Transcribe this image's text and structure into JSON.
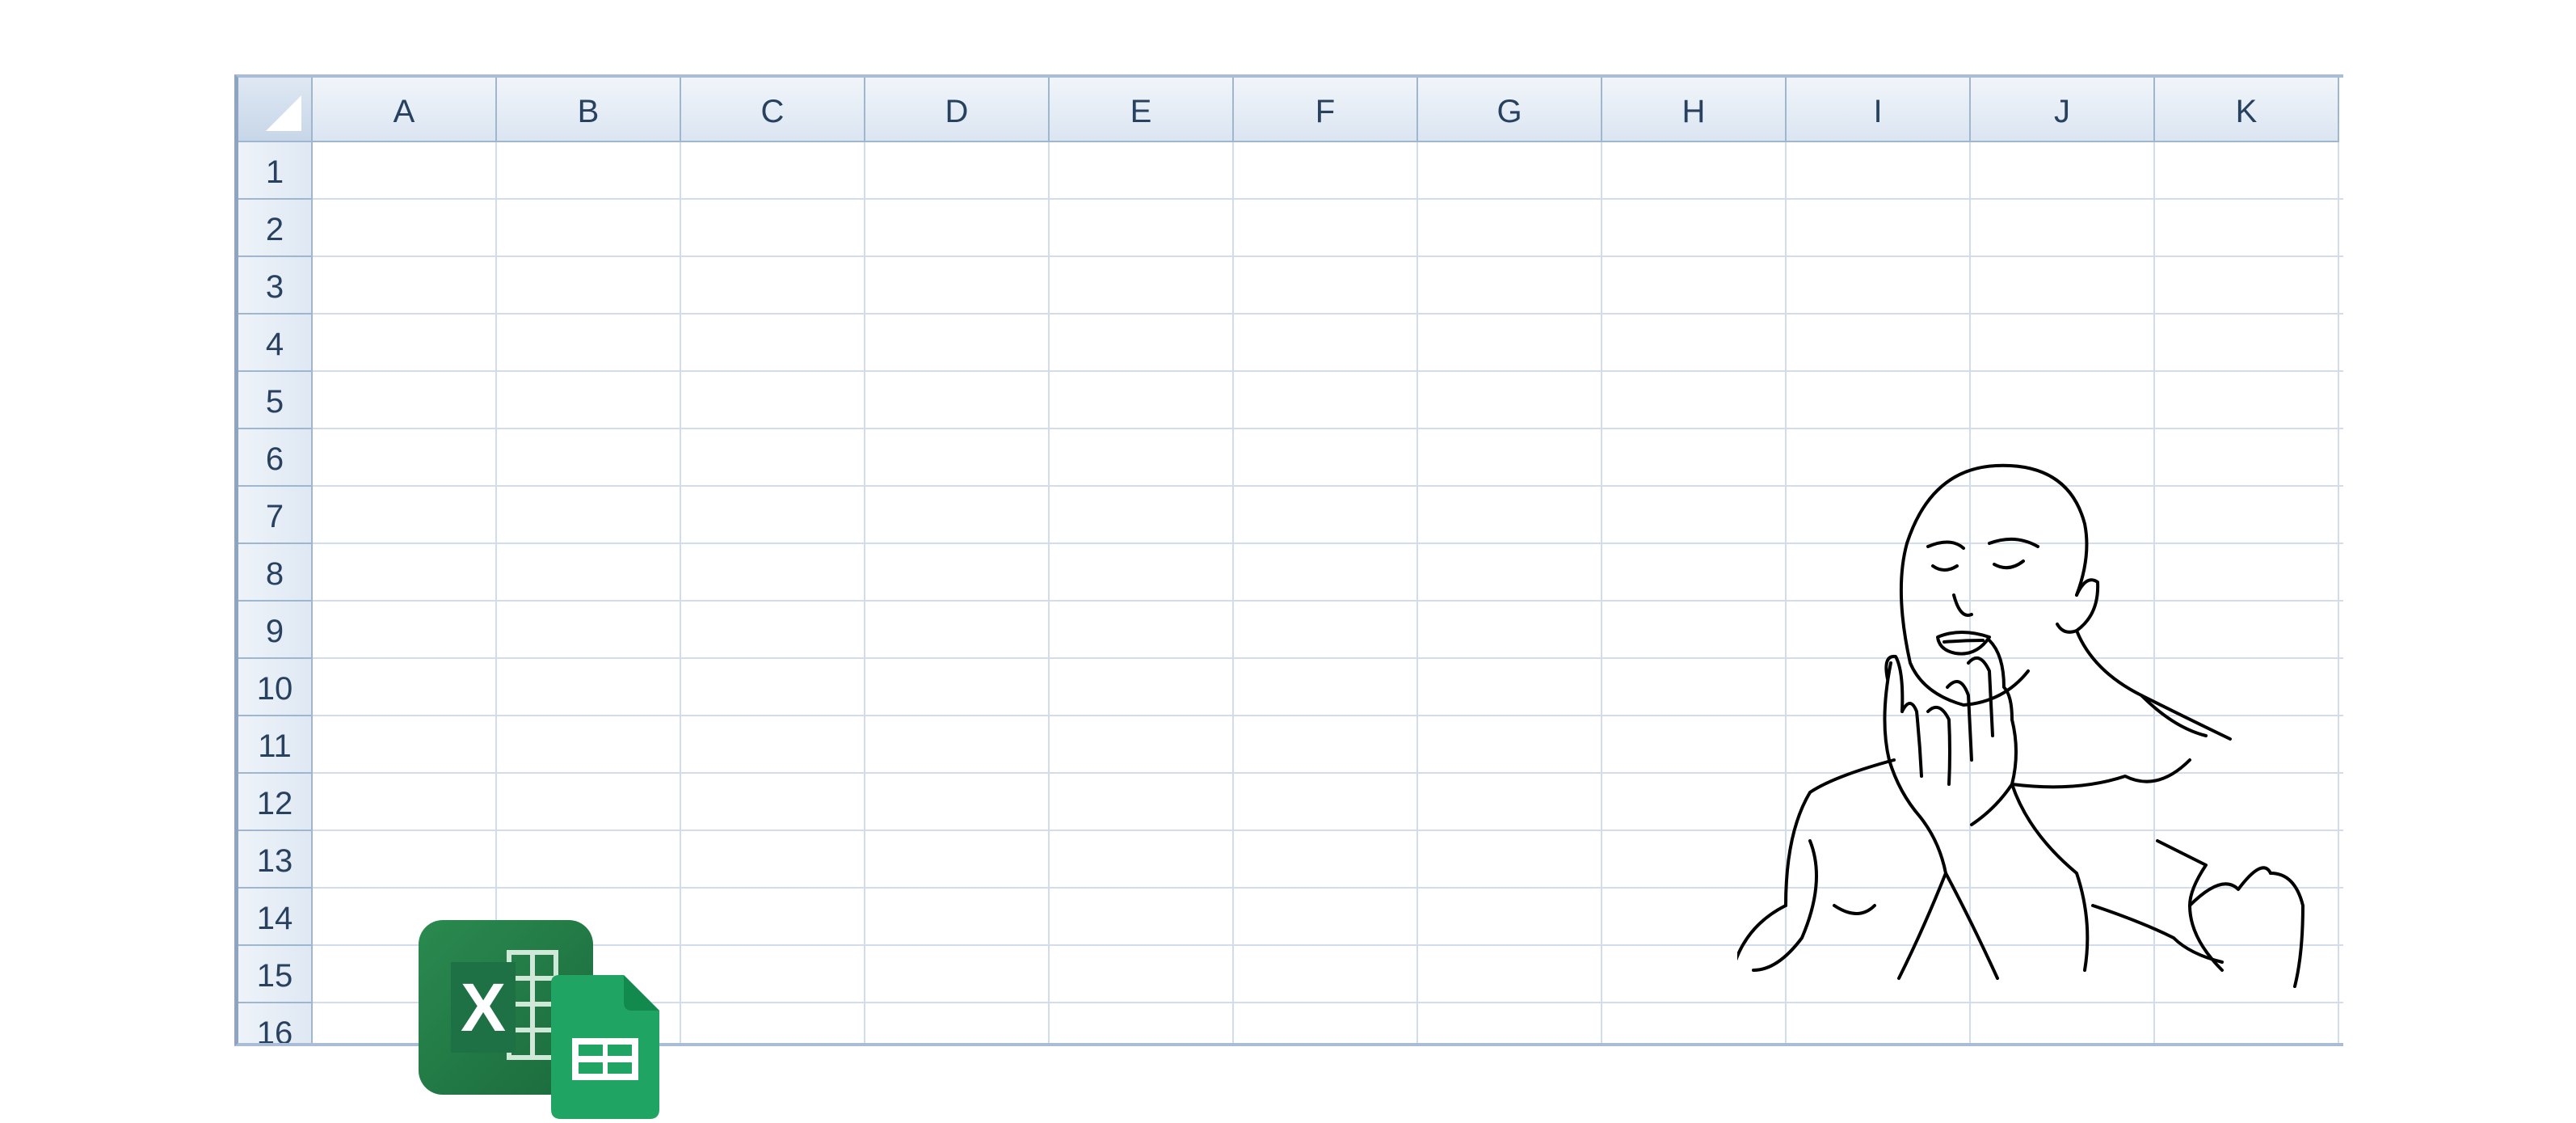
{
  "sheet": {
    "columns": [
      "A",
      "B",
      "C",
      "D",
      "E",
      "F",
      "G",
      "H",
      "I",
      "J",
      "K"
    ],
    "rows": [
      "1",
      "2",
      "3",
      "4",
      "5",
      "6",
      "7",
      "8",
      "9",
      "10",
      "11",
      "12",
      "13",
      "14",
      "15",
      "16"
    ]
  },
  "icons": {
    "excel": {
      "name": "excel-logo-icon",
      "letter": "X",
      "color": "#1e7145"
    },
    "sheets": {
      "name": "google-sheets-logo-icon",
      "color": "#1fa463"
    }
  },
  "colors": {
    "header_bg": "#dbe5f1",
    "header_text": "#27415f",
    "gridline": "#d2dcea"
  }
}
